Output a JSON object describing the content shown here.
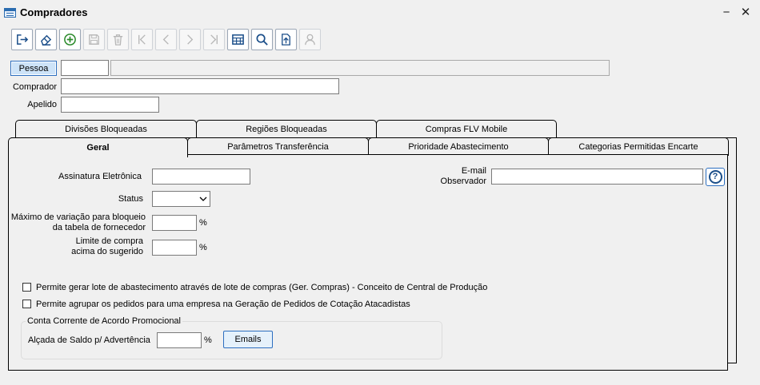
{
  "window": {
    "title": "Compradores",
    "minimize": "−",
    "close": "✕"
  },
  "toolbar": {
    "icons": [
      "exit-icon",
      "eraser-icon",
      "add-icon",
      "save-icon",
      "delete-icon",
      "first-icon",
      "prev-icon",
      "next-icon",
      "last-icon",
      "grid-icon",
      "search-icon",
      "export-icon",
      "user-icon"
    ]
  },
  "form": {
    "pessoa_button": "Pessoa",
    "pessoa_code": "",
    "pessoa_name": "",
    "comprador_label": "Comprador",
    "comprador_value": "",
    "apelido_label": "Apelido",
    "apelido_value": ""
  },
  "tabs_row1": [
    "Divisões Bloqueadas",
    "Regiões Bloqueadas",
    "Compras FLV Mobile"
  ],
  "tabs_row2": [
    "Geral",
    "Parâmetros Transferência",
    "Prioridade Abastecimento",
    "Categorias Permitidas Encarte"
  ],
  "geral": {
    "assinatura_label": "Assinatura Eletrônica",
    "assinatura_value": "",
    "status_label": "Status",
    "status_value": "",
    "max_var_label_1": "Máximo de variação para bloqueio",
    "max_var_label_2": "da tabela de fornecedor",
    "max_var_value": "",
    "limite_label_1": "Limite de compra",
    "limite_label_2": "acima do sugerido",
    "limite_value": "",
    "percent": "%",
    "email_label_1": "E-mail",
    "email_label_2": "Observador",
    "email_value": "",
    "help": "?",
    "check1": "Permite gerar lote de abastecimento através de lote de compras  (Ger. Compras) - Conceito de Central de Produção",
    "check2": "Permite agrupar os pedidos para uma empresa na Geração de Pedidos de Cotação Atacadistas",
    "group_title": "Conta Corrente de Acordo Promocional",
    "alcada_label": "Alçada de Saldo p/ Advertência",
    "alcada_value": "",
    "emails_button": "Emails"
  },
  "colors": {
    "accent": "#2d6fc0",
    "pressed": "#cde3f8"
  }
}
